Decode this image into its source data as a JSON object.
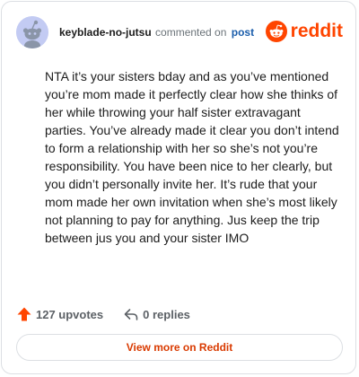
{
  "comment": {
    "username": "keyblade-no-jutsu",
    "action_text": "commented on",
    "post_link": "post",
    "body": "NTA it’s your sisters bday and as you’ve mentioned you’re mom made it perfectly clear how she thinks of her while throwing your half sister extravagant parties. You’ve already made it clear you don’t intend to form a relationship with her so she’s not you’re responsibility. You have been nice to her clearly, but you didn’t personally invite her. It’s rude that your mom made her own invitation when she’s most likely not planning to pay for anything. Jus keep the trip between jus you and your sister IMO"
  },
  "brand": {
    "name": "reddit",
    "icon": "reddit-snoo-icon",
    "color": "#ff4500"
  },
  "avatar": {
    "icon": "snoo-avatar-icon",
    "background": "#c3cbf3"
  },
  "stats": {
    "upvotes_label": "127 upvotes",
    "upvote_icon": "upvote-arrow-icon",
    "upvote_color": "#ff4500",
    "replies_label": "0 replies",
    "reply_icon": "reply-arrow-icon"
  },
  "footer": {
    "view_more_label": "View more on Reddit",
    "accent": "#d93a00"
  }
}
